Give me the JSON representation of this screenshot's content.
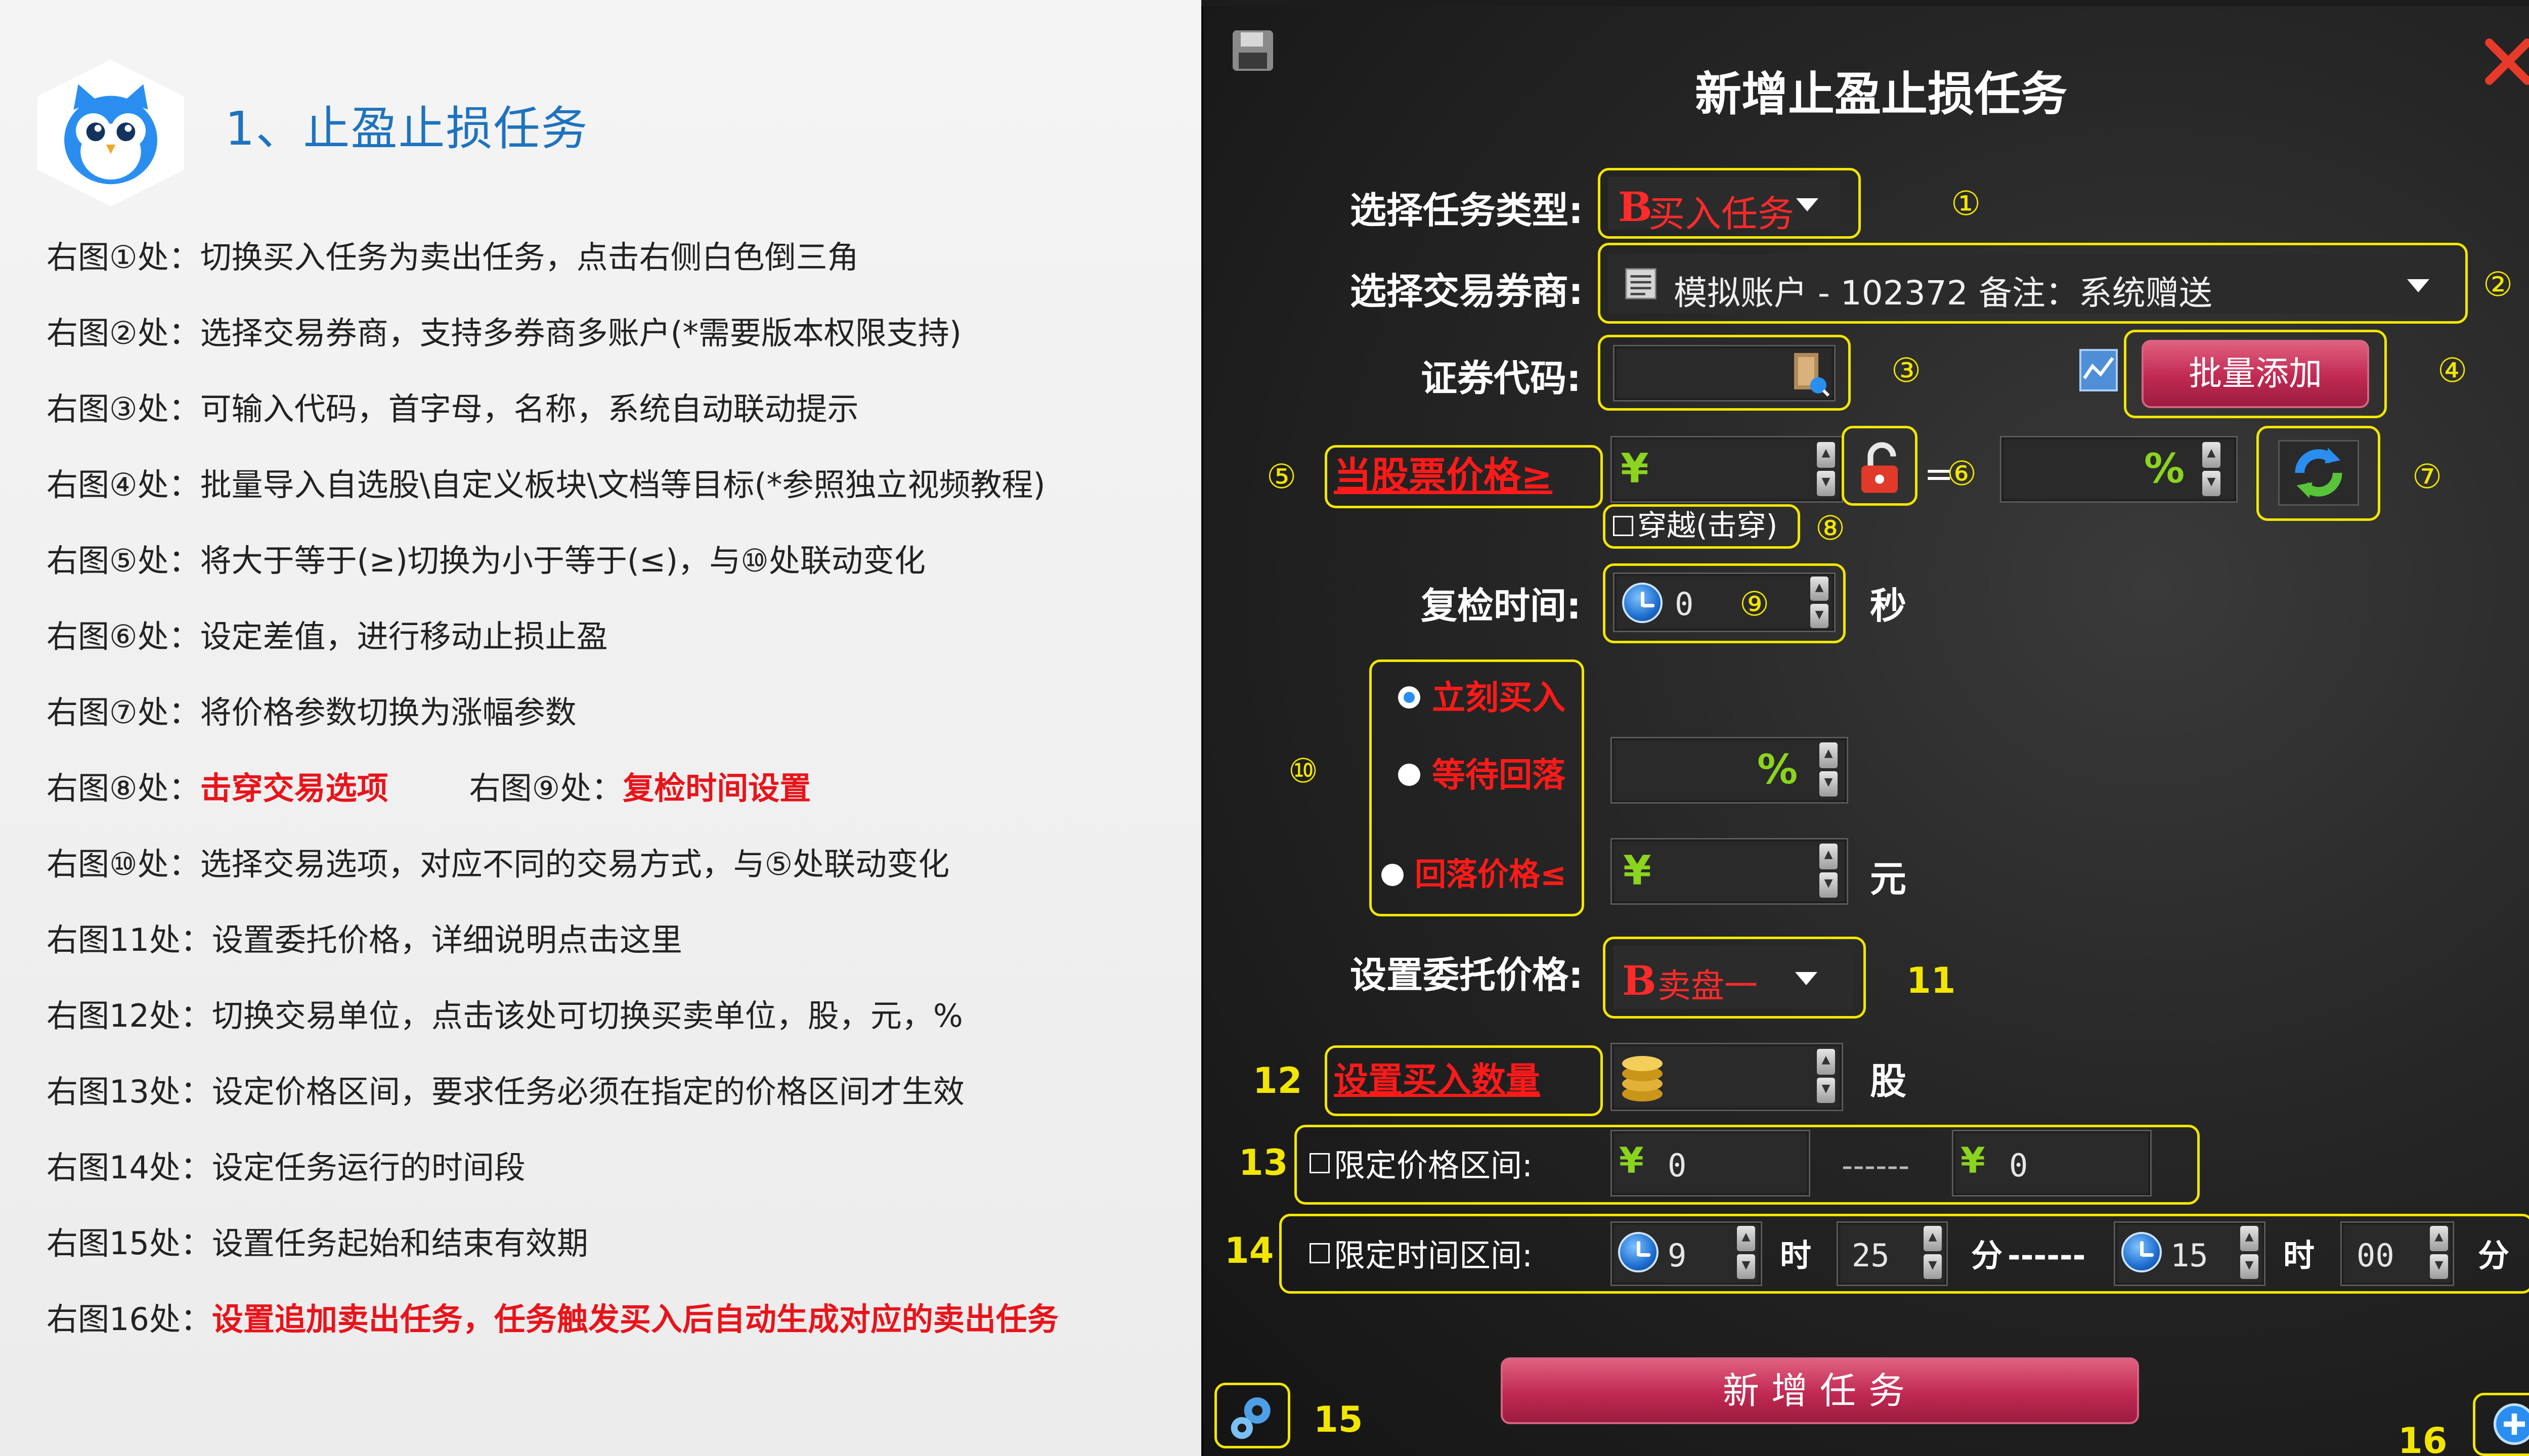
{
  "left": {
    "title": "1、止盈止损任务",
    "notes": [
      "右图①处：切换买入任务为卖出任务，点击右侧白色倒三角",
      "右图②处：选择交易券商，支持多券商多账户(*需要版本权限支持)",
      "右图③处：可输入代码，首字母，名称，系统自动联动提示",
      "右图④处：批量导入自选股\\自定义板块\\文档等目标(*参照独立视频教程)",
      "右图⑤处：将大于等于(≥)切换为小于等于(≤)，与⑩处联动变化",
      "右图⑥处：设定差值，进行移动止损止盈",
      "右图⑦处：将价格参数切换为涨幅参数"
    ],
    "note8_prefix": "右图⑧处：",
    "note8_red": "击穿交易选项",
    "note9_prefix": "右图⑨处：",
    "note9_red": "复检时间设置",
    "notes2": [
      "右图⑩处：选择交易选项，对应不同的交易方式，与⑤处联动变化",
      "右图11处：设置委托价格，详细说明点击这里",
      "右图12处：切换交易单位，点击该处可切换买卖单位，股，元，%",
      "右图13处：设定价格区间，要求任务必须在指定的价格区间才生效",
      "右图14处：设定任务运行的时间段",
      "右图15处：设置任务起始和结束有效期"
    ],
    "note16_prefix": "右图16处：",
    "note16_red": "设置追加卖出任务，任务触发买入后自动生成对应的卖出任务"
  },
  "dialog": {
    "title": "新增止盈止损任务",
    "task_type_label": "选择任务类型:",
    "task_type_value": "买入任务",
    "task_type_prefix": "B",
    "broker_label": "选择交易券商:",
    "broker_value": "模拟账户 - 102372 备注：系统赠送",
    "code_label": "证券代码:",
    "batch_add": "批量添加",
    "price_condition": "当股票价格≥",
    "yen": "¥",
    "equals": "=",
    "pct": "%",
    "cross_label": "穿越(击穿)",
    "recheck_label": "复检时间:",
    "recheck_value": "0",
    "seconds": "秒",
    "opt_immediate": "立刻买入",
    "opt_wait": "等待回落",
    "opt_fallback": "回落价格≤",
    "yuan": "元",
    "entrust_label": "设置委托价格:",
    "entrust_prefix": "B",
    "entrust_value": "卖盘一",
    "qty_label": "设置买入数量",
    "shares": "股",
    "price_range_label": "限定价格区间:",
    "price_min": "0",
    "price_dash": "------",
    "price_max": "0",
    "time_range_label": "限定时间区间:",
    "start_hour": "9",
    "hour": "时",
    "start_min": "25",
    "minute": "分",
    "time_dash": "------",
    "end_hour": "15",
    "end_min": "00",
    "add_task": "新增任务"
  },
  "markers": {
    "m1": "①",
    "m2": "②",
    "m3": "③",
    "m4": "④",
    "m5": "⑤",
    "m6": "⑥",
    "m7": "⑦",
    "m8": "⑧",
    "m9": "⑨",
    "m10": "⑩",
    "m11": "11",
    "m12": "12",
    "m13": "13",
    "m14": "14",
    "m15": "15",
    "m16": "16"
  },
  "colors": {
    "accent_red": "#e8141b",
    "title_blue": "#1e73be",
    "marker_yellow": "#f2e600",
    "button_pink": "#c02952",
    "green_symbol": "#8bd41f"
  },
  "icons": [
    "owl-logo-icon",
    "save-icon",
    "close-icon",
    "account-list-icon",
    "stock-search-icon",
    "chart-icon",
    "lock-icon",
    "refresh-icon",
    "clock-icon",
    "coins-icon",
    "gears-icon",
    "plus-icon"
  ]
}
